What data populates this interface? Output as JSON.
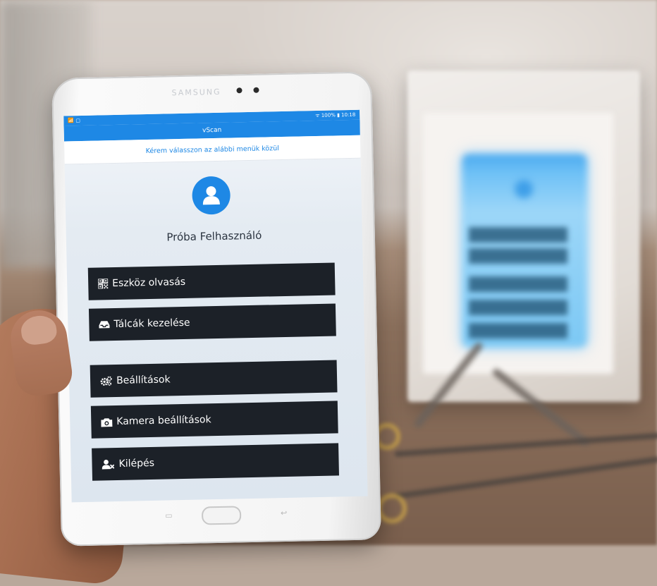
{
  "status_bar": {
    "left": "📶 ▢",
    "right": "ᯤ 100% ▮ 10:18"
  },
  "app": {
    "title": "vScan"
  },
  "subtitle": "Kérem válasszon az alábbi menük közül",
  "user": {
    "name": "Próba Felhasználó",
    "avatar_icon": "user-icon"
  },
  "menu": [
    {
      "id": "eszkoz",
      "label": "Eszköz olvasás",
      "icon": "qr-code-icon"
    },
    {
      "id": "talcak",
      "label": "Tálcák kezelése",
      "icon": "tray-icon"
    },
    {
      "id": "beallitasok",
      "label": "Beállítások",
      "icon": "gears-icon"
    },
    {
      "id": "kamera",
      "label": "Kamera beállítások",
      "icon": "camera-icon"
    },
    {
      "id": "kilepes",
      "label": "Kilépés",
      "icon": "user-remove-icon"
    }
  ],
  "device": {
    "brand": "SAMSUNG"
  },
  "colors": {
    "primary": "#1e88e5",
    "button": "#1c2128"
  }
}
